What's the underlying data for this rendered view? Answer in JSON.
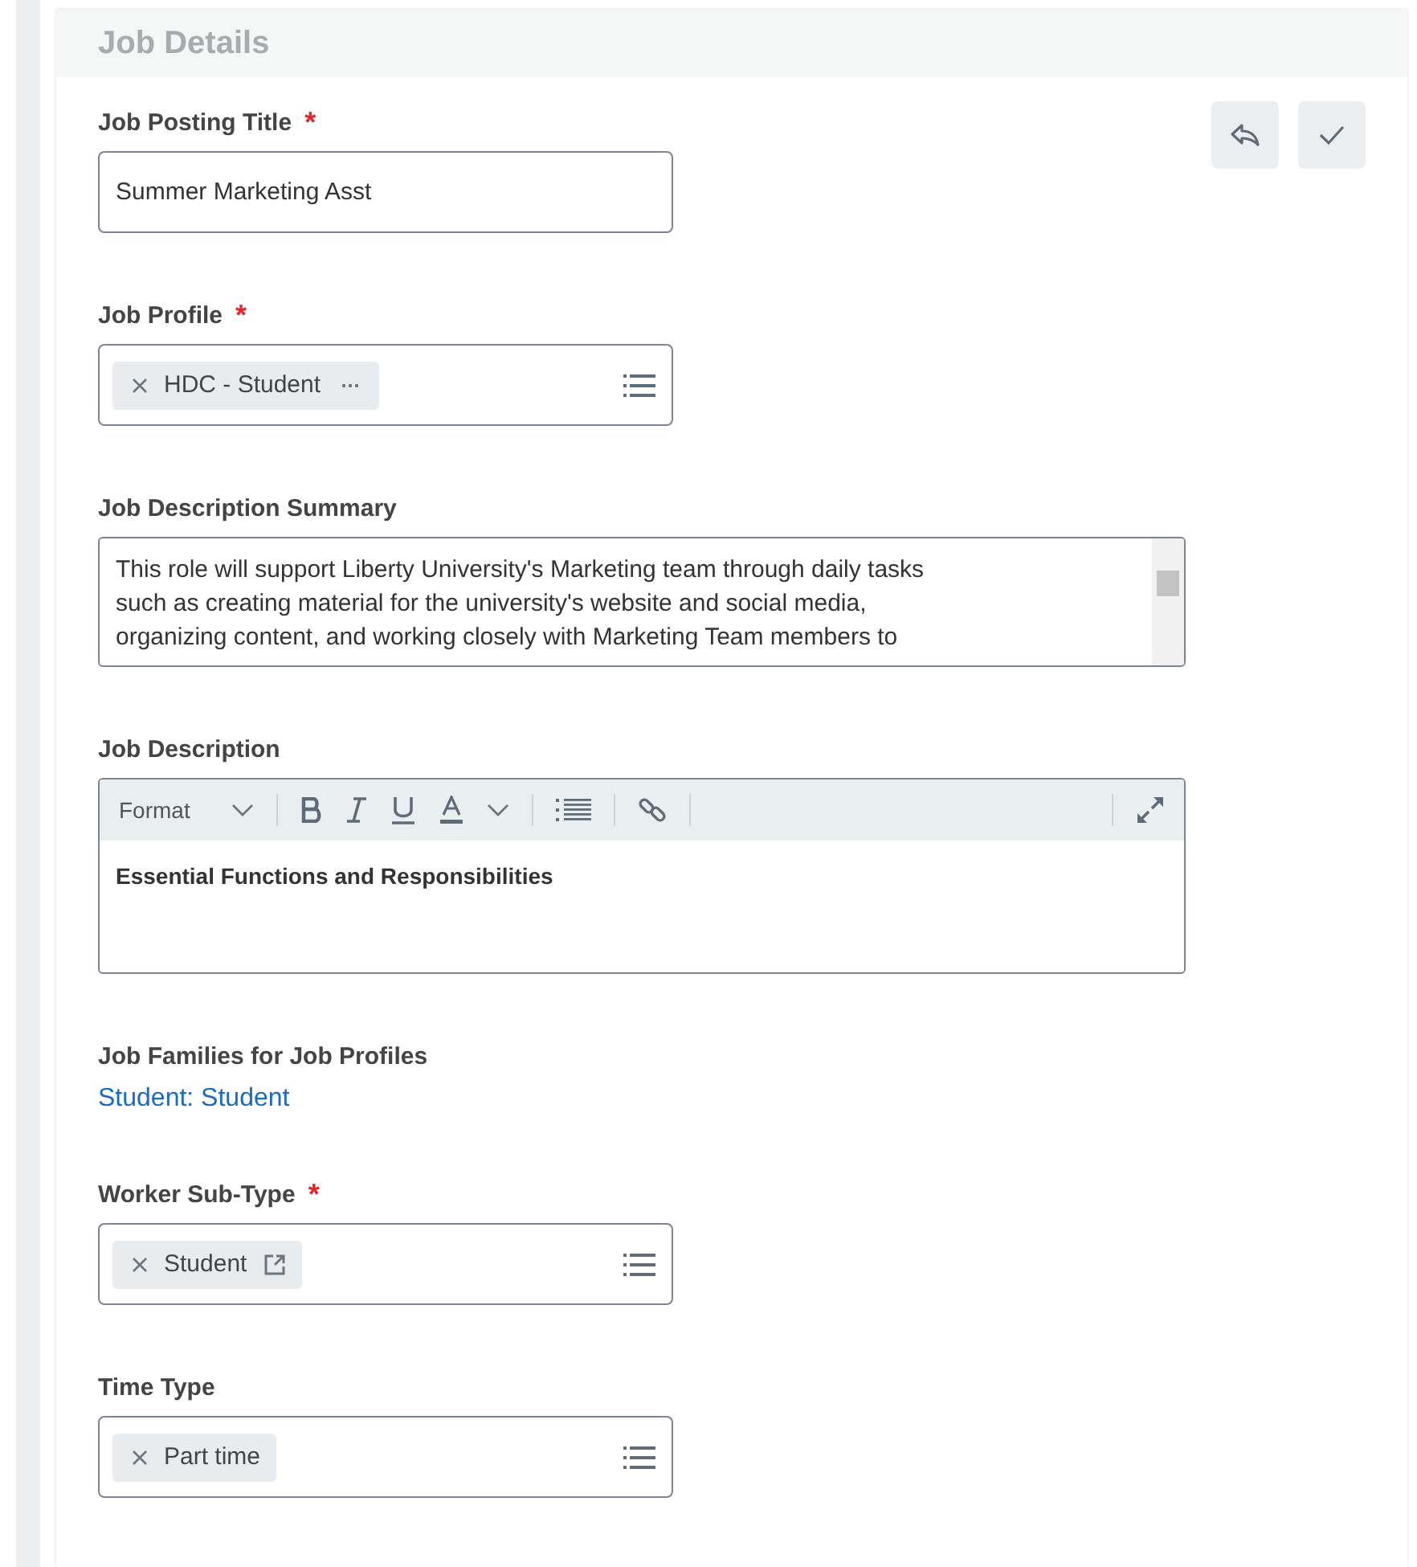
{
  "section": {
    "title": "Job Details"
  },
  "actions": [
    {
      "kind": "undo"
    },
    {
      "kind": "confirm"
    }
  ],
  "fields": [
    {
      "kind": "text",
      "label": "Job Posting Title",
      "required_mark": "*",
      "value": "Summer Marketing Asst"
    },
    {
      "kind": "prompt",
      "label": "Job Profile",
      "required_mark": "*",
      "chips": [
        {
          "text": "HDC - Student",
          "kind": "more"
        }
      ]
    },
    {
      "kind": "textarea",
      "label": "Job Description Summary",
      "lines": [
        "This role will support Liberty University's Marketing team through daily tasks",
        "such as creating material for the university's website and social media,",
        "organizing content, and working closely with Marketing Team members to"
      ]
    },
    {
      "kind": "richtext",
      "label": "Job Description",
      "format": "Format",
      "body": "Essential Functions and Responsibilities"
    },
    {
      "kind": "link",
      "label": "Job Families for Job Profiles",
      "link": "Student: Student"
    },
    {
      "kind": "prompt",
      "label": "Worker Sub-Type",
      "required_mark": "*",
      "chips": [
        {
          "text": "Student",
          "kind": "external"
        }
      ]
    },
    {
      "kind": "prompt",
      "label": "Time Type",
      "chips": [
        {
          "text": "Part time",
          "kind": "plain"
        }
      ]
    }
  ]
}
